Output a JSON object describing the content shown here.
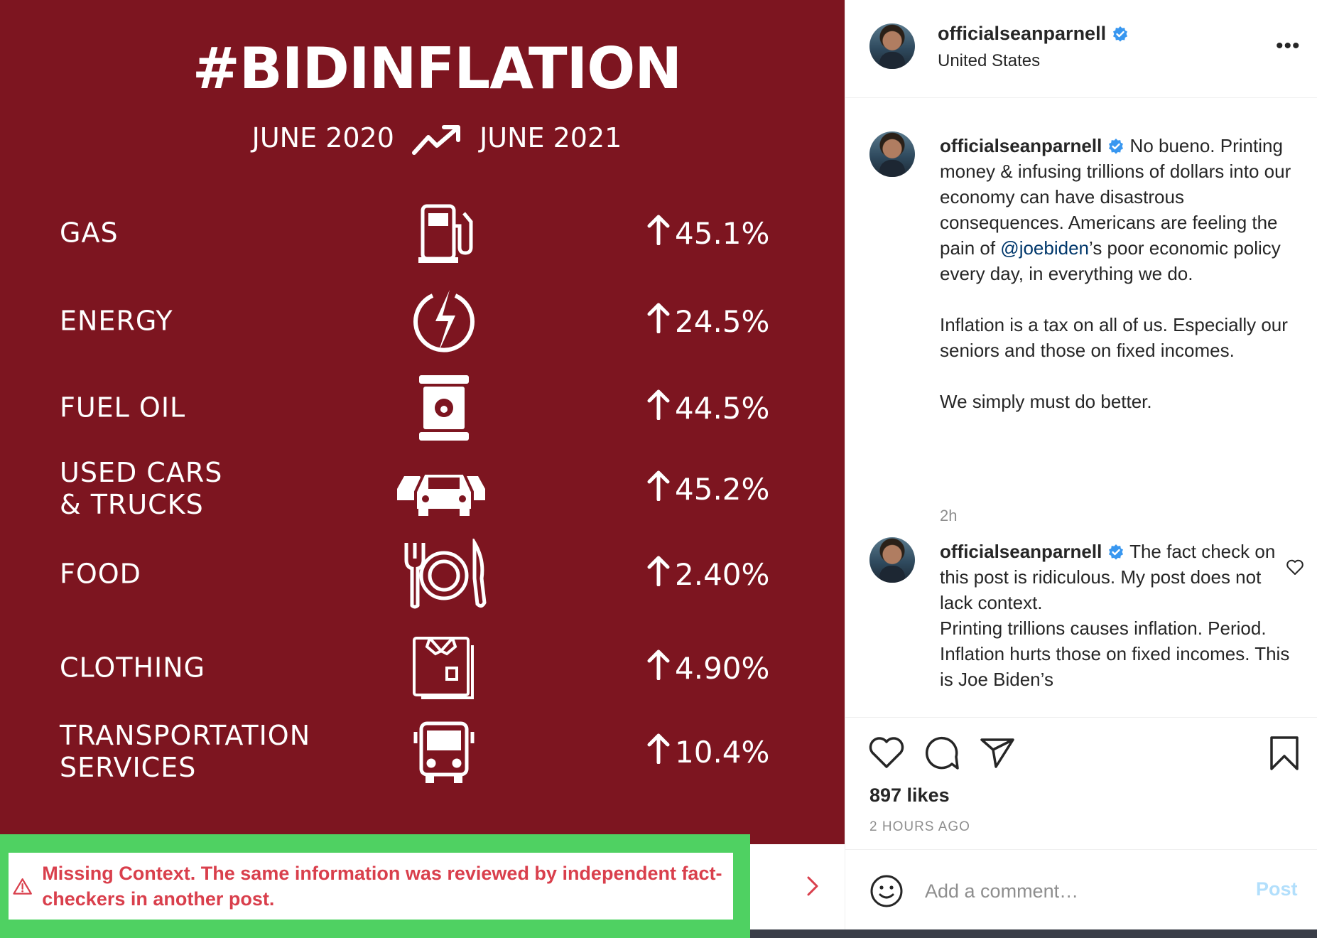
{
  "infographic": {
    "title": "#BIDINFLATION",
    "date_from": "JUNE 2020",
    "date_to": "JUNE 2021",
    "rows": [
      {
        "label": "GAS",
        "icon": "gas-pump-icon",
        "value": "45.1%"
      },
      {
        "label": "ENERGY",
        "icon": "lightning-bolt-icon",
        "value": "24.5%"
      },
      {
        "label": "FUEL OIL",
        "icon": "oil-barrel-icon",
        "value": "44.5%"
      },
      {
        "label": "USED CARS\n& TRUCKS",
        "icon": "cars-icon",
        "value": "45.2%"
      },
      {
        "label": "FOOD",
        "icon": "plate-cutlery-icon",
        "value": "2.40%"
      },
      {
        "label": "CLOTHING",
        "icon": "shirt-icon",
        "value": "4.90%"
      },
      {
        "label": "TRANSPORTATION\nSERVICES",
        "icon": "bus-icon",
        "value": "10.4%"
      }
    ]
  },
  "factcheck": {
    "text": "Missing Context. The same information was reviewed by independent fact-checkers in another post."
  },
  "header": {
    "username": "officialseanparnell",
    "location": "United States",
    "more": "•••"
  },
  "caption": {
    "username": "officialseanparnell",
    "text_before": " No bueno. Printing money & infusing trillions of dollars into our economy can have disastrous consequences. Americans are feeling the pain of ",
    "mention": "@joebiden",
    "text_after": "’s poor economic policy every day, in everything we do.\n\nInflation is a tax on all of us. Especially our seniors and those on fixed incomes.\n\nWe simply must do better.",
    "time": "2h"
  },
  "reply": {
    "username": "officialseanparnell",
    "text": " The fact check on this post is ridiculous. My post does not lack context.\nPrinting trillions causes inflation. Period.\nInflation hurts those on fixed incomes. This is Joe Biden’s"
  },
  "stats": {
    "likes": "897 likes",
    "time": "2 HOURS AGO"
  },
  "comment_box": {
    "placeholder": "Add a comment…",
    "post_label": "Post"
  },
  "colors": {
    "image_background": "#7d1520",
    "factcheck_frame": "#4fd162",
    "factcheck_text": "#d93f4c",
    "verified_badge": "#3897f0",
    "mention": "#00376b",
    "post_button_disabled": "#b2dffc"
  }
}
